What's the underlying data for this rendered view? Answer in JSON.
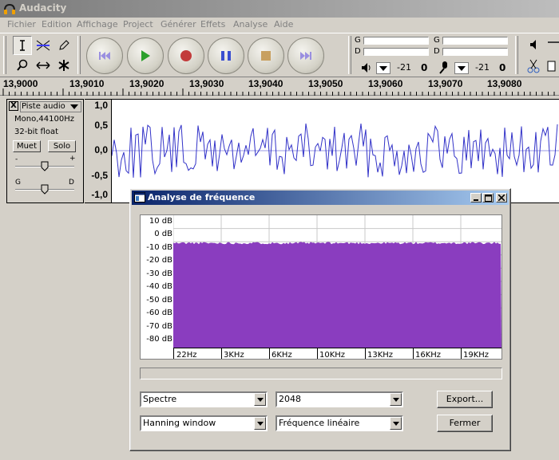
{
  "window": {
    "title": "Audacity"
  },
  "menu": [
    "Fichier",
    "Edition",
    "Affichage",
    "Project",
    "Générer",
    "Effets",
    "Analyse",
    "Aide"
  ],
  "meters": {
    "play_left": "G",
    "play_right": "D",
    "rec_left": "G",
    "rec_right": "D",
    "play_db": "-21",
    "play_val": "0",
    "rec_db": "-21",
    "rec_val": "0"
  },
  "ruler": [
    "13,9000",
    "13,9010",
    "13,9020",
    "13,9030",
    "13,9040",
    "13,9050",
    "13,9060",
    "13,9070",
    "13,9080"
  ],
  "track": {
    "name": "Piste audio",
    "info_rate": "Mono,44100Hz",
    "info_format": "32-bit float",
    "mute_label": "Muet",
    "solo_label": "Solo",
    "gain_minus": "-",
    "gain_plus": "+",
    "pan_left": "G",
    "pan_right": "D",
    "close_glyph": "X",
    "vscale": [
      "1,0",
      "0,5",
      "0,0",
      "-0,5",
      "-1,0"
    ]
  },
  "dialog": {
    "title": "Analyse de fréquence",
    "db_labels": [
      "10 dB",
      "0 dB",
      "-10 dB",
      "-20 dB",
      "-30 dB",
      "-40 dB",
      "-50 dB",
      "-60 dB",
      "-70 dB",
      "-80 dB"
    ],
    "hz_labels": [
      "22Hz",
      "3KHz",
      "6KHz",
      "10KHz",
      "13KHz",
      "16KHz",
      "19KHz"
    ],
    "algorithm": "Spectre",
    "size": "2048",
    "window_func": "Hanning window",
    "axis_mode": "Fréquence linéaire",
    "export_label": "Export...",
    "close_label": "Fermer",
    "spectrum_color": "#8a3dbf",
    "spectrum_level_db": -11
  },
  "colors": {
    "waveform": "#3232c8",
    "dialog_title_start": "#0a246a",
    "dialog_title_end": "#a6caf0"
  }
}
